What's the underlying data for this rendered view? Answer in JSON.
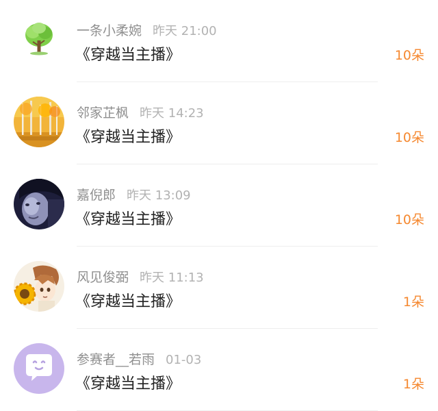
{
  "messages": [
    {
      "name": "一条小柔婉",
      "time": "昨天 21:00",
      "title": "《穿越当主播》",
      "gift": "10朵",
      "avatar": "tree-avatar"
    },
    {
      "name": "邻家芷枫",
      "time": "昨天 14:23",
      "title": "《穿越当主播》",
      "gift": "10朵",
      "avatar": "autumn-forest-avatar"
    },
    {
      "name": "嘉倪郎",
      "time": "昨天 13:09",
      "title": "《穿越当主播》",
      "gift": "10朵",
      "avatar": "face-photo-avatar"
    },
    {
      "name": "风见俊弼",
      "time": "昨天 11:13",
      "title": "《穿越当主播》",
      "gift": "1朵",
      "avatar": "anime-sunflower-avatar"
    },
    {
      "name": "参赛者__若雨",
      "time": "01-03",
      "title": "《穿越当主播》",
      "gift": "1朵",
      "avatar": "chat-bubble-avatar"
    }
  ],
  "colors": {
    "gift_orange": "#f5882f",
    "name_gray": "#8f8f8f",
    "time_gray": "#b2b2b2",
    "purple_avatar": "#c8b6ec"
  }
}
